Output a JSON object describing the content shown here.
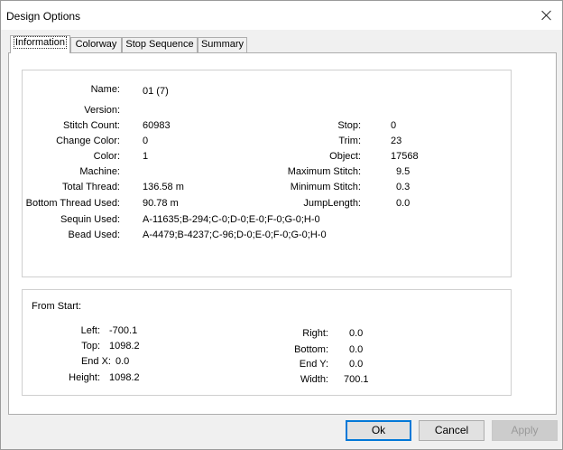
{
  "window": {
    "title": "Design Options",
    "close_label": ""
  },
  "tabs": [
    "Information",
    "Colorway",
    "Stop Sequence",
    "Summary"
  ],
  "info": {
    "name_label": "Name:",
    "name_value": "01 (7)",
    "version_label": "Version:",
    "version_value": "",
    "stitch_count_label": "Stitch Count:",
    "stitch_count_value": "60983",
    "change_color_label": "Change Color:",
    "change_color_value": "0",
    "color_label": "Color:",
    "color_value": "1",
    "machine_label": "Machine:",
    "machine_value": "",
    "total_thread_label": "Total Thread:",
    "total_thread_value": "136.58 m",
    "bottom_thread_label": "Bottom Thread Used:",
    "bottom_thread_value": "90.78 m",
    "sequin_label": "Sequin Used:",
    "sequin_value": "A-11635;B-294;C-0;D-0;E-0;F-0;G-0;H-0",
    "bead_label": "Bead Used:",
    "bead_value": "A-4479;B-4237;C-96;D-0;E-0;F-0;G-0;H-0",
    "stop_label": "Stop:",
    "stop_value": "0",
    "trim_label": "Trim:",
    "trim_value": "23",
    "object_label": "Object:",
    "object_value": "17568",
    "max_stitch_label": "Maximum Stitch:",
    "max_stitch_value": "9.5",
    "min_stitch_label": "Minimum Stitch:",
    "min_stitch_value": "0.3",
    "jump_label": "JumpLength:",
    "jump_value": "0.0"
  },
  "from_start": {
    "heading": "From Start:",
    "left_label": "Left:",
    "left_value": "-700.1",
    "top_label": "Top:",
    "top_value": "1098.2",
    "endx_label": "End X:",
    "endx_value": "0.0",
    "height_label": "Height:",
    "height_value": "1098.2",
    "right_label": "Right:",
    "right_value": "0.0",
    "bottom_label": "Bottom:",
    "bottom_value": "0.0",
    "endy_label": "End Y:",
    "endy_value": "0.0",
    "width_label": "Width:",
    "width_value": "700.1"
  },
  "buttons": {
    "ok": "Ok",
    "cancel": "Cancel",
    "apply": "Apply"
  }
}
